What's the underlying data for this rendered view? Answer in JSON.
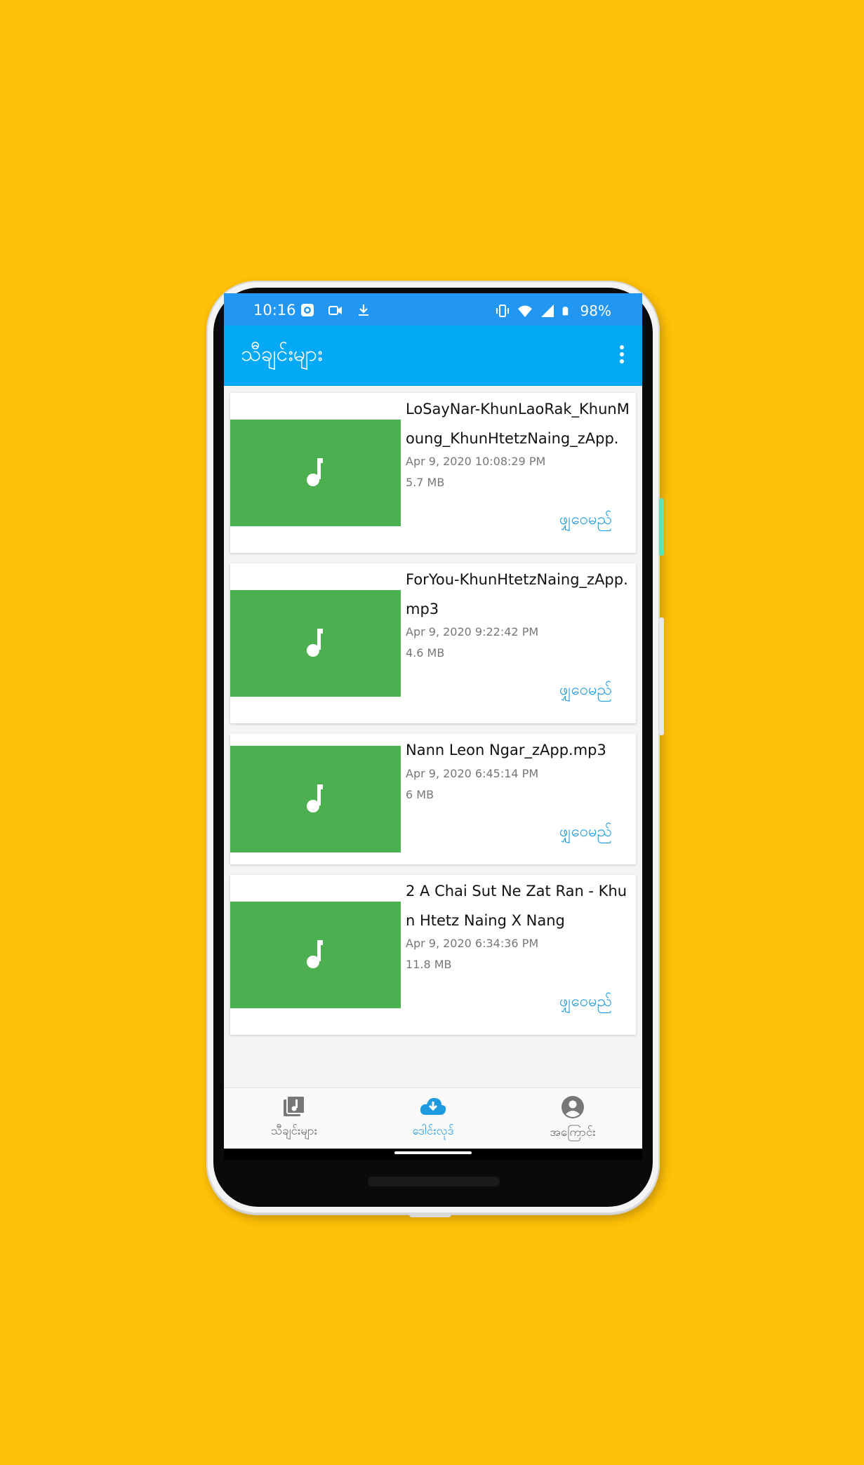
{
  "status_bar": {
    "time": "10:16",
    "battery": "98%",
    "left_icons": [
      "screen-record-icon",
      "video-icon",
      "download-icon"
    ],
    "right_icons": [
      "vibrate-icon",
      "wifi-icon",
      "signal-icon",
      "battery-icon"
    ]
  },
  "app_bar": {
    "title": "သီချင်းများ",
    "menu_icon": "more-vert-icon"
  },
  "files": [
    {
      "name": "LoSayNar-KhunLaoRak_KhunMoung_KhunHtetzNaing_zApp.",
      "date": "Apr 9, 2020 10:08:29 PM",
      "size": "5.7 MB",
      "action": "ဖျှဝေမည်"
    },
    {
      "name": "ForYou-KhunHtetzNaing_zApp.mp3",
      "date": "Apr 9, 2020 9:22:42 PM",
      "size": "4.6 MB",
      "action": "ဖျှဝေမည်"
    },
    {
      "name": "Nann Leon Ngar_zApp.mp3",
      "date": "Apr 9, 2020 6:45:14 PM",
      "size": "6 MB",
      "action": "ဖျှဝေမည်"
    },
    {
      "name": "2 A Chai Sut Ne Zat Ran - Khun Htetz Naing X Nang",
      "date": "Apr 9, 2020 6:34:36 PM",
      "size": "11.8 MB",
      "action": "ဖျှဝေမည်"
    }
  ],
  "bottom_nav": {
    "items": [
      {
        "label": "သီချင်းများ",
        "icon": "music-library-icon",
        "active": false
      },
      {
        "label": "ဒေါင်းလုဒ်",
        "icon": "cloud-download-icon",
        "active": true
      },
      {
        "label": "အကြောင်း",
        "icon": "account-circle-icon",
        "active": false
      }
    ]
  },
  "colors": {
    "background": "#FFC107",
    "status_bar": "#2196F3",
    "app_bar": "#03A9F4",
    "thumbnail": "#4CAF50",
    "accent": "#1E9BE0"
  }
}
